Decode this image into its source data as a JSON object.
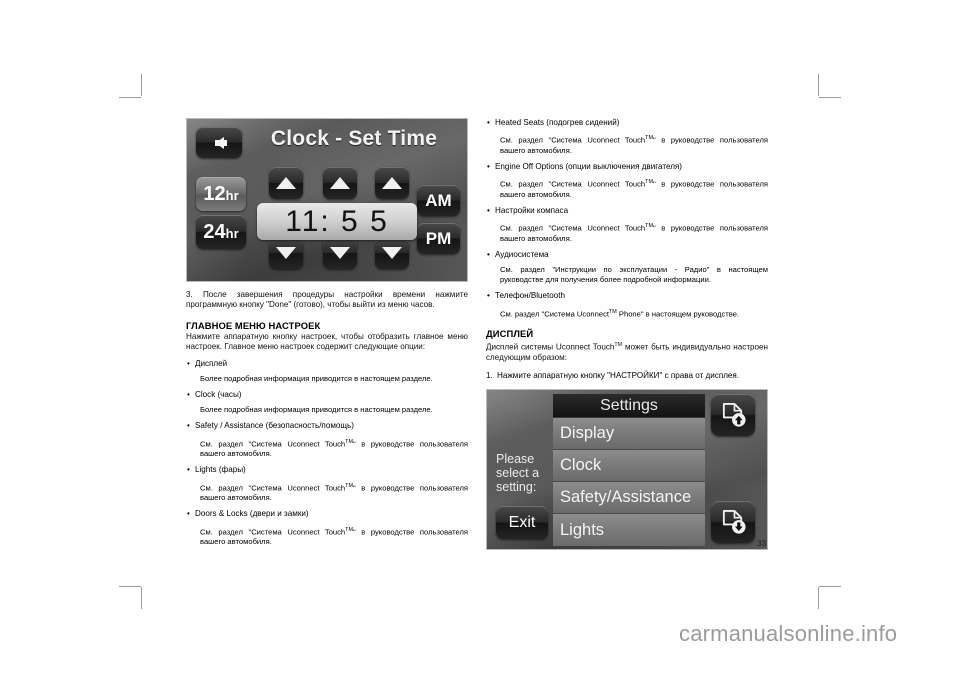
{
  "page": {
    "number": "33",
    "watermark": "carmanualsonline.info"
  },
  "clock_screen": {
    "back_icon": "arrow-left-icon",
    "title": "Clock - Set Time",
    "format_12": "12",
    "format_12_unit": "hr",
    "format_24": "24",
    "format_24_unit": "hr",
    "time_value": "11: 5 5",
    "am_label": "AM",
    "pm_label": "PM",
    "up_arrows": [
      "▲",
      "▲",
      "▲"
    ],
    "down_arrows": [
      "▼",
      "▼",
      "▼"
    ]
  },
  "settings_screen": {
    "prompt": "Please select a setting:",
    "exit_label": "Exit",
    "menu_title": "Settings",
    "menu_items": [
      "Display",
      "Clock",
      "Safety/Assistance",
      "Lights"
    ],
    "page_up_icon": "page-up-icon",
    "page_down_icon": "page-down-icon"
  },
  "left_column": {
    "step3": "3. После завершения процедуры настройки времени нажмите программную кнопку \"Done\" (готово), чтобы выйти из меню часов.",
    "heading": "ГЛАВНОЕ МЕНЮ НАСТРОЕК",
    "intro": "Нажмите аппаратную кнопку настроек, чтобы отобразить главное меню настроек. Главное меню настроек содержит следующие опции:",
    "bullets": [
      {
        "label": "Дисплей",
        "note_parts": [
          "Более подробная информация приводится в настоящем разделе."
        ]
      },
      {
        "label": "Clock (часы)",
        "note_parts": [
          "Более подробная информация приводится в настоящем разделе."
        ]
      },
      {
        "label": "Safety / Assistance (безопасность/помощь)",
        "note_pre": "См. раздел \"Система Uconnect Touch",
        "note_tm": "TM",
        "note_post": "\" в руководстве пользователя вашего автомобиля."
      },
      {
        "label": "Lights (фары)",
        "note_pre": "См. раздел \"Система Uconnect Touch",
        "note_tm": "TM",
        "note_post": "\" в руководстве пользователя вашего автомобиля."
      },
      {
        "label": "Doors & Locks (двери и замки)",
        "note_pre": "См. раздел \"Система Uconnect Touch",
        "note_tm": "TM",
        "note_post": "\" в руководстве пользователя вашего автомобиля."
      }
    ]
  },
  "right_column": {
    "bullets": [
      {
        "label": "Heated Seats (подогрев сидений)",
        "note_pre": "См. раздел \"Система Uconnect Touch",
        "note_tm": "TM",
        "note_post": "\" в руководстве пользователя вашего автомобиля."
      },
      {
        "label": "Engine Off Options (опции выключения двигателя)",
        "note_pre": "См. раздел \"Система Uconnect Touch",
        "note_tm": "TM",
        "note_post": "\" в руководстве пользователя вашего автомобиля."
      },
      {
        "label": "Настройки компаса",
        "note_pre": "См. раздел \"Система Uconnect Touch",
        "note_tm": "TM",
        "note_post": "\" в руководстве пользователя вашего автомобиля."
      },
      {
        "label": "Аудиосистема",
        "note_pre": "См. раздел \"Инструкции по эксплуатации - Радио\" в настоящем руководстве для получения более подробной информации.",
        "note_tm": "",
        "note_post": ""
      },
      {
        "label": "Телефон/Bluetooth",
        "note_pre": "См. раздел \"Система Uconnect",
        "note_tm": "TM",
        "note_post": " Phone\" в настоящем руководстве."
      }
    ],
    "heading": "ДИСПЛЕЙ",
    "intro_pre": "Дисплей системы Uconnect Touch",
    "intro_tm": "TM",
    "intro_post": " может быть индивидуально настроен следующим образом:",
    "step1_num": "1.",
    "step1": "Нажмите аппаратную кнопку \"НАСТРОЙКИ\" с права от дисплея."
  }
}
